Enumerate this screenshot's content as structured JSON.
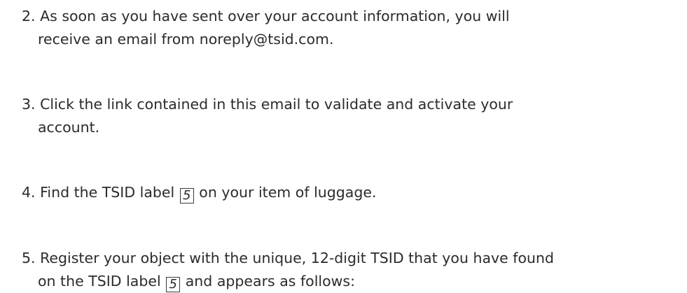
{
  "steps": [
    {
      "number": "2.",
      "lines": [
        "As soon as you have sent over your account information, you will",
        "receive an email from noreply@tsid.com."
      ]
    },
    {
      "number": "3.",
      "lines": [
        "Click the link contained in this email to validate and activate your",
        "account."
      ]
    },
    {
      "number": "4.",
      "before_ref": " Find the TSID label",
      "ref": "5",
      "after_ref": "on your item of luggage."
    },
    {
      "number": "5.",
      "line1": "Register your object with the unique, 12-digit TSID that you have found",
      "line2_before_ref": "on the TSID label",
      "ref": "5",
      "line2_after_ref": "and appears as follows:"
    }
  ]
}
